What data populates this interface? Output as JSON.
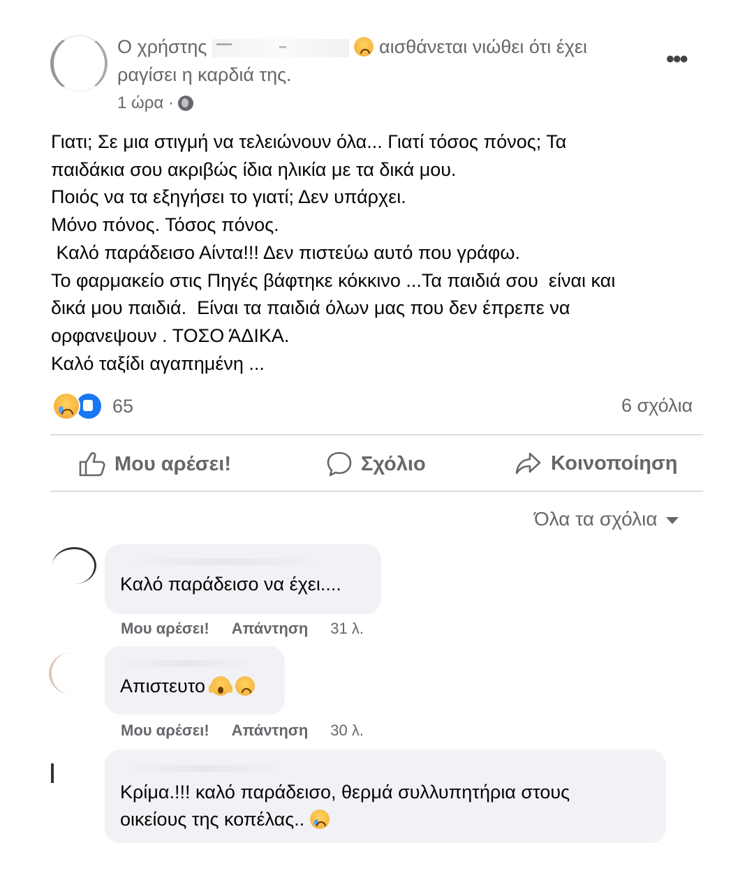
{
  "post": {
    "author_prefix": "Ο χρήστης",
    "feeling_text": "αισθάνεται νιώθει ότι έχει",
    "feeling_text_line2": "ραγίσει η καρδιά της.",
    "time": "1 ώρα ·",
    "body_lines": [
      "Γιατι; Σε μια στιγμή να τελειώνουν όλα... Γιατί τόσος πόνος; Τα",
      "παιδάκια σου ακριβώς ίδια ηλικία με τα δικά μου.",
      "Ποιός να τα εξηγήσει το γιατί; Δεν υπάρχει.",
      "Μόνο πόνος. Τόσος πόνος.",
      " Καλό παράδεισο Αίντα!!! Δεν πιστεύω αυτό που γράφω.",
      "Το φαρμακείο στις Πηγές βάφτηκε κόκκινο ...Τα παιδιά σου  είναι και",
      "δικά μου παιδιά.  Είναι τα παιδιά όλων μας που δεν έπρεπε να",
      "ορφανεψουν . ΤΟΣΟ ΆΔΙΚΑ.",
      "Καλό ταξίδι αγαπημένη ..."
    ],
    "reaction_count": "65",
    "comment_count": "6 σχόλια",
    "reaction_icons": [
      "sad-icon",
      "like-icon"
    ]
  },
  "actions": {
    "like": "Μου αρέσει!",
    "comment": "Σχόλιο",
    "share": "Κοινοποίηση"
  },
  "comments_filter": "Όλα τα σχόλια",
  "comments": [
    {
      "text": "Καλό παράδεισο να έχει....",
      "like": "Μου αρέσει!",
      "reply": "Απάντηση",
      "time": "31 λ."
    },
    {
      "text": "Απιστευτο",
      "like": "Μου αρέσει!",
      "reply": "Απάντηση",
      "time": "30 λ.",
      "emojis": [
        "scream-icon",
        "sad-icon"
      ]
    },
    {
      "text_line1": "Κρίμα.!!! καλό παράδεισο, θερμά συλλυπητήρια στους",
      "text_line2": "οικείους της κοπέλας..",
      "emojis": [
        "crying-icon"
      ]
    }
  ],
  "colors": {
    "secondary_text": "#65676b",
    "bubble_bg": "#f0f2f5",
    "divider": "#dadde1",
    "like_blue": "#1877f2"
  }
}
